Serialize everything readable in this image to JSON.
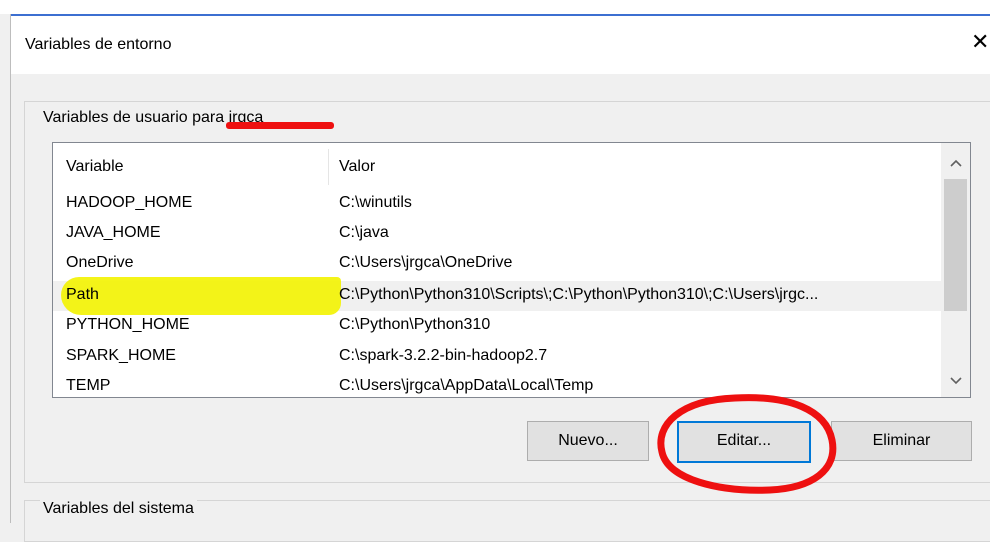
{
  "window": {
    "title": "Variables de entorno",
    "close_glyph": "✕"
  },
  "user_vars": {
    "legend": "Variables de usuario para jrgca",
    "columns": {
      "variable": "Variable",
      "valor": "Valor"
    },
    "rows": [
      {
        "variable": "HADOOP_HOME",
        "valor": "C:\\winutils"
      },
      {
        "variable": "JAVA_HOME",
        "valor": "C:\\java"
      },
      {
        "variable": "OneDrive",
        "valor": "C:\\Users\\jrgca\\OneDrive"
      },
      {
        "variable": "Path",
        "valor": "C:\\Python\\Python310\\Scripts\\;C:\\Python\\Python310\\;C:\\Users\\jrgc..."
      },
      {
        "variable": "PYTHON_HOME",
        "valor": "C:\\Python\\Python310"
      },
      {
        "variable": "SPARK_HOME",
        "valor": "C:\\spark-3.2.2-bin-hadoop2.7"
      },
      {
        "variable": "TEMP",
        "valor": "C:\\Users\\jrgca\\AppData\\Local\\Temp"
      }
    ],
    "buttons": {
      "nuevo": "Nuevo...",
      "editar": "Editar...",
      "eliminar": "Eliminar"
    }
  },
  "system_vars": {
    "legend": "Variables del sistema"
  },
  "icons": {
    "scroll_up": "chevron-up-icon",
    "scroll_down": "chevron-down-icon",
    "close": "close-icon"
  },
  "colors": {
    "highlight": "#f3f300",
    "annotation": "#ee1010",
    "focus": "#0078d7"
  }
}
